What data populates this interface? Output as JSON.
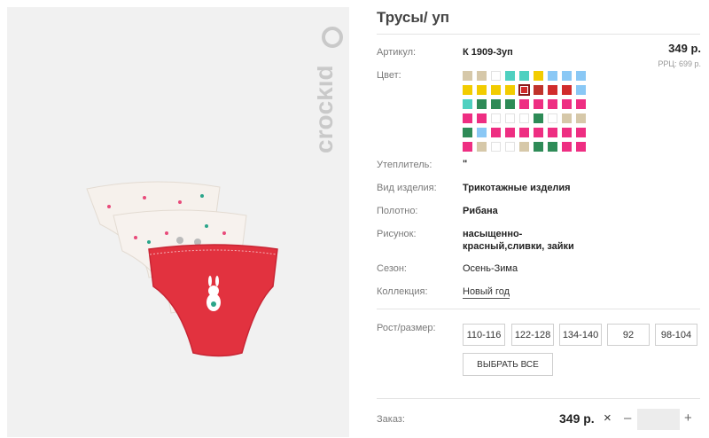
{
  "product": {
    "title": "Трусы/ уп",
    "brand_logo_text": "crockid"
  },
  "fields": {
    "article": {
      "label": "Артикул:",
      "value": "К 1909-3уп"
    },
    "price": {
      "value": "349 р.",
      "rrp": "РРЦ: 699 р."
    },
    "color": {
      "label": "Цвет:"
    },
    "insulation": {
      "label": "Утеплитель:",
      "value": "\""
    },
    "type": {
      "label": "Вид изделия:",
      "value": "Трикотажные изделия"
    },
    "fabric": {
      "label": "Полотно:",
      "value": "Рибана"
    },
    "pattern": {
      "label": "Рисунок:",
      "line1": "насыщенно-",
      "line2": "красный,сливки, зайки"
    },
    "season": {
      "label": "Сезон:",
      "value": "Осень-Зима"
    },
    "collection": {
      "label": "Коллекция:",
      "value": "Новый год"
    }
  },
  "swatches": [
    "#d6c8a9",
    "#d6c8a9",
    "#ffffff",
    "#4fd0c0",
    "#4fd0c0",
    "#f2cc00",
    "#8ac8f5",
    "#8ac8f5",
    "#8ac8f5",
    "#f2cc00",
    "#f2cc00",
    "#f2cc00",
    "#f2cc00",
    "#d12c2c",
    "#c0322a",
    "#d12c2c",
    "#d12c2c",
    "#8ac8f5",
    "#4fd0c0",
    "#2e8b57",
    "#2e8b57",
    "#2e8b57",
    "#ee2e82",
    "#ee2e82",
    "#ee2e82",
    "#ee2e82",
    "#ee2e82",
    "#ee2e82",
    "#ee2e82",
    "#ffffff",
    "#ffffff",
    "#ffffff",
    "#2e8b57",
    "#ffffff",
    "#d6c8a9",
    "#d6c8a9",
    "#2e8b57",
    "#8ac8f5",
    "#ee2e82",
    "#ee2e82",
    "#ee2e82",
    "#ee2e82",
    "#ee2e82",
    "#ee2e82",
    "#ee2e82",
    "#ee2e82",
    "#d6c8a9",
    "#ffffff",
    "#ffffff",
    "#d6c8a9",
    "#2e8b57",
    "#2e8b57",
    "#ee2e82",
    "#ee2e82"
  ],
  "selected_swatch_index": 13,
  "sizes": {
    "label": "Рост/размер:",
    "options": [
      "110-116",
      "122-128",
      "134-140",
      "92",
      "98-104"
    ],
    "select_all": "ВЫБРАТЬ ВСЕ"
  },
  "order": {
    "label": "Заказ:",
    "price": "349 р.",
    "times": "×",
    "minus": "–",
    "plus": "+",
    "qty_value": ""
  }
}
